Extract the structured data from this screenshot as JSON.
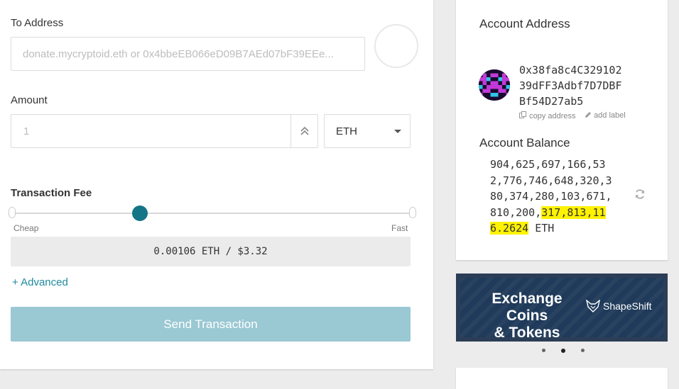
{
  "form": {
    "to_address_label": "To Address",
    "to_address_placeholder": "donate.mycryptoid.eth or 0x4bbeEB066eD09B7AEd07bF39EEe...",
    "amount_label": "Amount",
    "amount_placeholder": "1",
    "unit_selected": "ETH",
    "fee_label": "Transaction Fee",
    "fee_slider_level": 0.32,
    "fee_slider_min_label": "Cheap",
    "fee_slider_max_label": "Fast",
    "fee_display": "0.00106 ETH / $3.32",
    "advanced_link": "+ Advanced",
    "send_button": "Send Transaction"
  },
  "account": {
    "address_title": "Account Address",
    "address": "0x38fa8c4C32910239dFF3Adbf7D7DBFBf54D27ab5",
    "address_lines": [
      "0x38fa8c4C329102",
      "39dFF3Adbf7D7DBF",
      "Bf54D27ab5"
    ],
    "copy_address": "copy address",
    "add_label": "add label",
    "balance_title": "Account Balance",
    "balance_lines_plain": [
      "904,625,697,166,53",
      "2,776,746,648,320,3",
      "80,374,280,103,671,"
    ],
    "balance_line4_plain": "810,200,",
    "balance_line4_highlight": "317,813,11",
    "balance_line5_highlight": "6.2624",
    "balance_unit": " ETH"
  },
  "promo": {
    "line1": "Exchange Coins",
    "line2": "& Tokens",
    "brand": "ShapeShift"
  },
  "colors": {
    "accent": "#147586",
    "link": "#1f8aa0",
    "button_disabled": "#9ac8d3",
    "highlight": "#fff200",
    "promo_bg": "#1f3a5a"
  },
  "icons": [
    "double-chevron-up-icon",
    "caret-down-icon",
    "copy-icon",
    "pencil-icon",
    "refresh-icon",
    "fox-logo-icon"
  ]
}
